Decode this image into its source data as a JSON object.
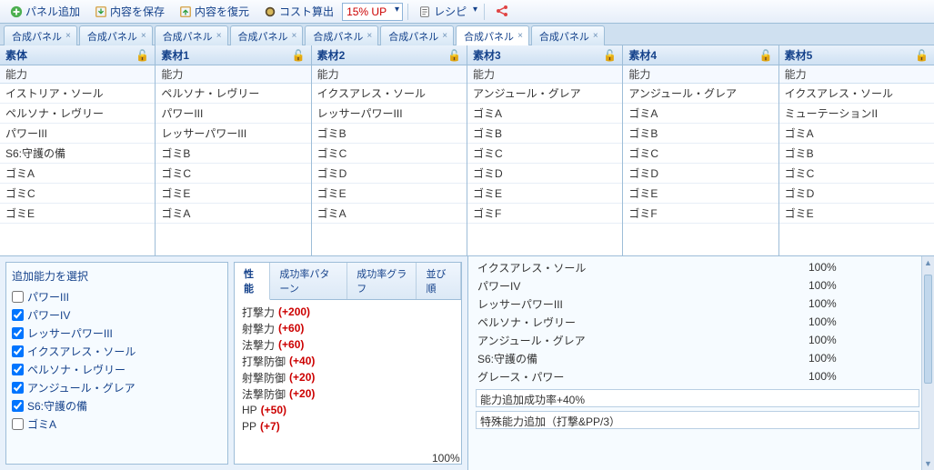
{
  "toolbar": {
    "add_panel": "パネル追加",
    "save_content": "内容を保存",
    "restore_content": "内容を復元",
    "cost_calc": "コスト算出",
    "rate_dropdown": "15% UP",
    "recipe_label": "レシピ"
  },
  "tabs": [
    {
      "label": "合成パネル",
      "active": false
    },
    {
      "label": "合成パネル",
      "active": false
    },
    {
      "label": "合成パネル",
      "active": false
    },
    {
      "label": "合成パネル",
      "active": false
    },
    {
      "label": "合成パネル",
      "active": false
    },
    {
      "label": "合成パネル",
      "active": false
    },
    {
      "label": "合成パネル",
      "active": true
    },
    {
      "label": "合成パネル",
      "active": false
    }
  ],
  "slot_headers": [
    "素体",
    "素材1",
    "素材2",
    "素材3",
    "素材4",
    "素材5"
  ],
  "slot_subheader": "能力",
  "lock_icon": "🔓",
  "slots": [
    [
      "イストリア・ソール",
      "ペルソナ・レヴリー",
      "パワーIII",
      "S6:守護の備",
      "ゴミA",
      "ゴミC",
      "ゴミE"
    ],
    [
      "ペルソナ・レヴリー",
      "パワーIII",
      "レッサーパワーIII",
      "ゴミB",
      "ゴミC",
      "ゴミE",
      "ゴミA"
    ],
    [
      "イクスアレス・ソール",
      "レッサーパワーIII",
      "ゴミB",
      "ゴミC",
      "ゴミD",
      "ゴミE",
      "ゴミA"
    ],
    [
      "アンジュール・グレア",
      "ゴミA",
      "ゴミB",
      "ゴミC",
      "ゴミD",
      "ゴミE",
      "ゴミF"
    ],
    [
      "アンジュール・グレア",
      "ゴミA",
      "ゴミB",
      "ゴミC",
      "ゴミD",
      "ゴミE",
      "ゴミF"
    ],
    [
      "イクスアレス・ソール",
      "ミューテーションII",
      "ゴミA",
      "ゴミB",
      "ゴミC",
      "ゴミD",
      "ゴミE"
    ]
  ],
  "picker": {
    "legend": "追加能力を選択",
    "items": [
      {
        "label": "パワーIII",
        "checked": false
      },
      {
        "label": "パワーIV",
        "checked": true
      },
      {
        "label": "レッサーパワーIII",
        "checked": true
      },
      {
        "label": "イクスアレス・ソール",
        "checked": true
      },
      {
        "label": "ペルソナ・レヴリー",
        "checked": true
      },
      {
        "label": "アンジュール・グレア",
        "checked": true
      },
      {
        "label": "S6:守護の備",
        "checked": true
      },
      {
        "label": "ゴミA",
        "checked": false
      }
    ]
  },
  "mini_tabs": [
    "性能",
    "成功率パターン",
    "成功率グラフ",
    "並び順"
  ],
  "stats": [
    {
      "name": "打撃力",
      "value": "(+200)"
    },
    {
      "name": "射撃力",
      "value": "(+60)"
    },
    {
      "name": "法撃力",
      "value": "(+60)"
    },
    {
      "name": "打撃防御",
      "value": "(+40)"
    },
    {
      "name": "射撃防御",
      "value": "(+20)"
    },
    {
      "name": "法撃防御",
      "value": "(+20)"
    },
    {
      "name": "HP",
      "value": "(+50)"
    },
    {
      "name": "PP",
      "value": "(+7)"
    }
  ],
  "results": [
    {
      "name": "イクスアレス・ソール",
      "pct": "100%"
    },
    {
      "name": "パワーIV",
      "pct": "100%"
    },
    {
      "name": "レッサーパワーIII",
      "pct": "100%"
    },
    {
      "name": "ペルソナ・レヴリー",
      "pct": "100%"
    },
    {
      "name": "アンジュール・グレア",
      "pct": "100%"
    },
    {
      "name": "S6:守護の備",
      "pct": "100%"
    },
    {
      "name": "グレース・パワー",
      "pct": "100%"
    }
  ],
  "result_fields": [
    "能力追加成功率+40%",
    "特殊能力追加（打撃&PP/3）"
  ],
  "stray_pct": "100%"
}
